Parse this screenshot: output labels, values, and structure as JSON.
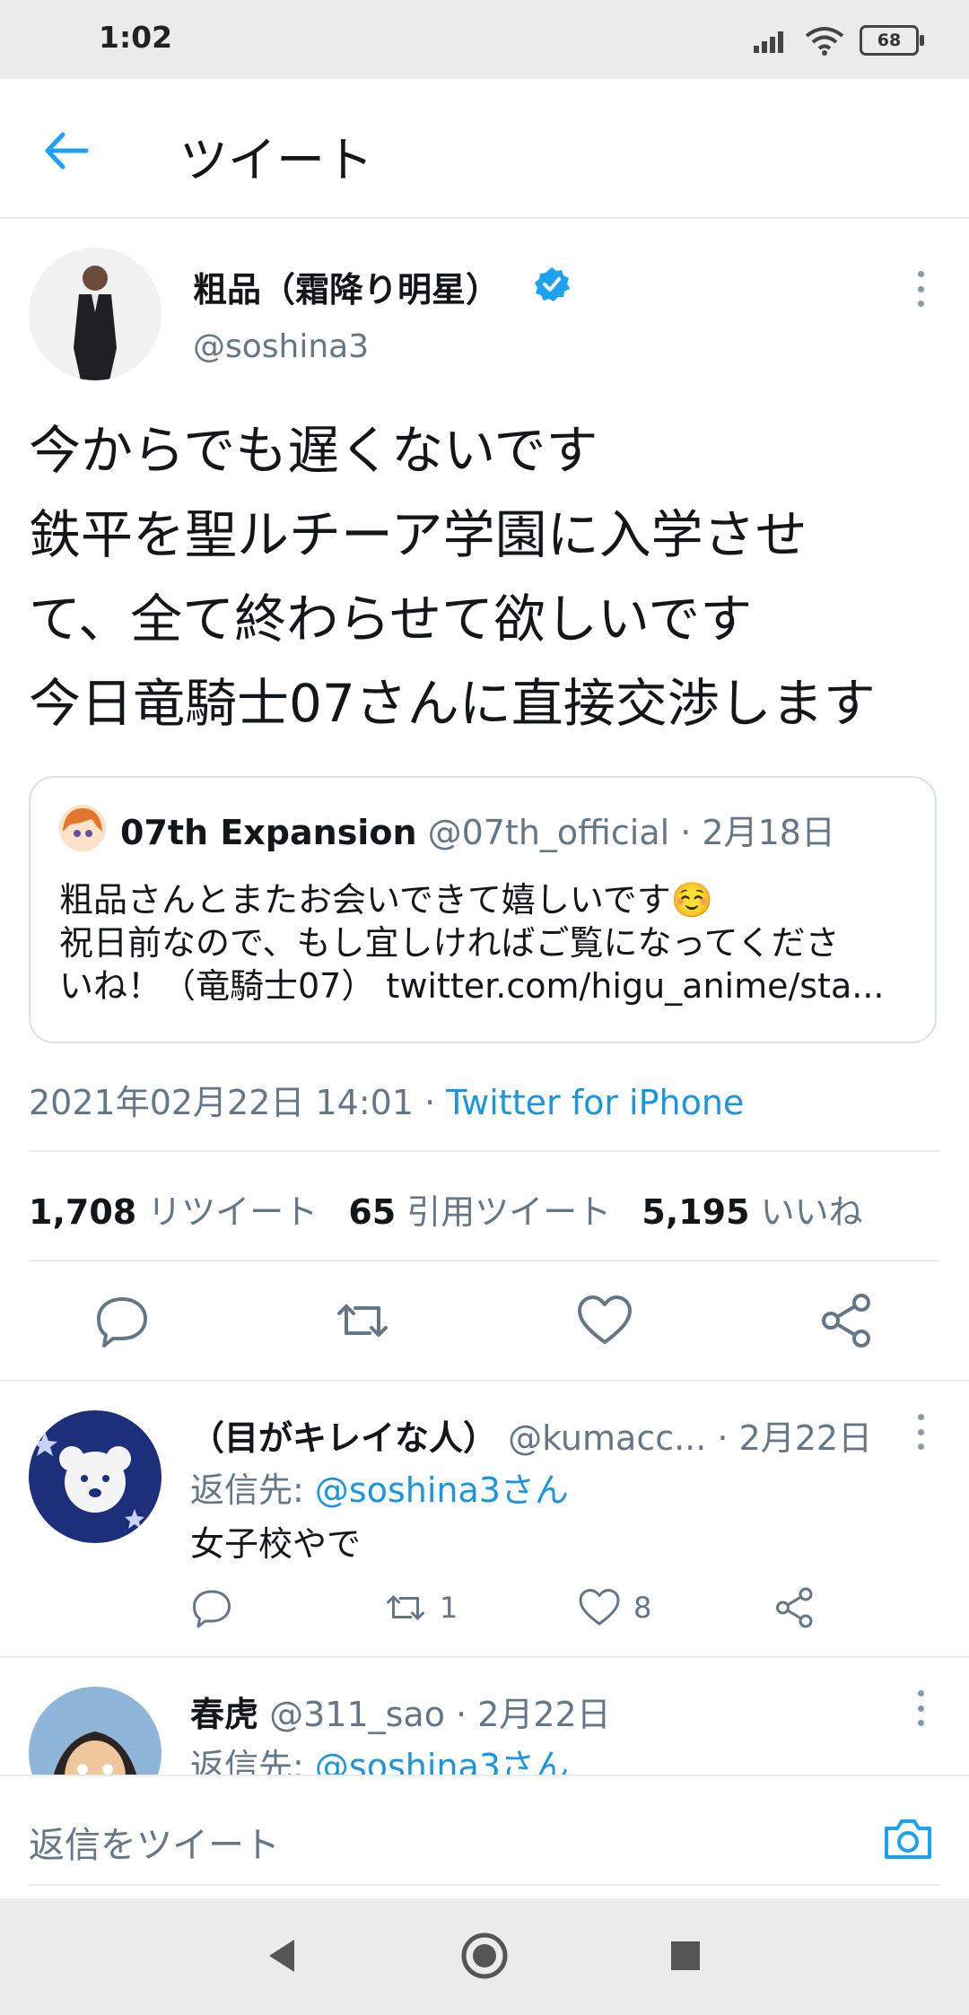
{
  "status_bar": {
    "time": "1:02",
    "battery": "68"
  },
  "header": {
    "title": "ツイート"
  },
  "tweet": {
    "author_name": "粗品（霜降り明星）",
    "handle": "@soshina3",
    "text_lines": [
      "今からでも遅くないです",
      "鉄平を聖ルチーア学園に入学させ",
      "て、全て終わらせて欲しいです",
      "今日竜騎士07さんに直接交渉します"
    ],
    "quote": {
      "name": "07th Expansion",
      "meta": " @07th_official · 2月18日",
      "lines": [
        "粗品さんとまたお会いできて嬉しいです☺️",
        "祝日前なので、もし宜しければご覧になってくださ",
        "いね！（竜騎士07） twitter.com/higu_anime/sta..."
      ]
    },
    "timestamp": "2021年02月22日 14:01 · ",
    "source": "Twitter for iPhone",
    "stats": [
      {
        "count": "1,708",
        "label": "リツイート"
      },
      {
        "count": "65",
        "label": "引用ツイート"
      },
      {
        "count": "5,195",
        "label": "いいね"
      }
    ]
  },
  "replies": [
    {
      "name": "（目がキレイな人）",
      "meta": " @kumacc... · 2月22日",
      "reply_to_prefix": "返信先: ",
      "reply_to_mention": "@soshina3さん",
      "text": "女子校やで",
      "retweets": "1",
      "likes": "8"
    },
    {
      "name": "春虎",
      "meta": " @311_sao · 2月22日",
      "reply_to_prefix": "返信先: ",
      "reply_to_mention": "@soshina3さん"
    }
  ],
  "reply_bar": {
    "placeholder": "返信をツイート"
  },
  "colors": {
    "accent": "#1da1f2",
    "secondary_text": "#657786",
    "divider": "#e6ecf0"
  },
  "icons": [
    "back-arrow-icon",
    "verified-badge-icon",
    "kebab-menu-icon",
    "reply-icon",
    "retweet-icon",
    "like-icon",
    "share-icon",
    "camera-icon",
    "nav-back-icon",
    "nav-home-icon",
    "nav-recents-icon"
  ]
}
